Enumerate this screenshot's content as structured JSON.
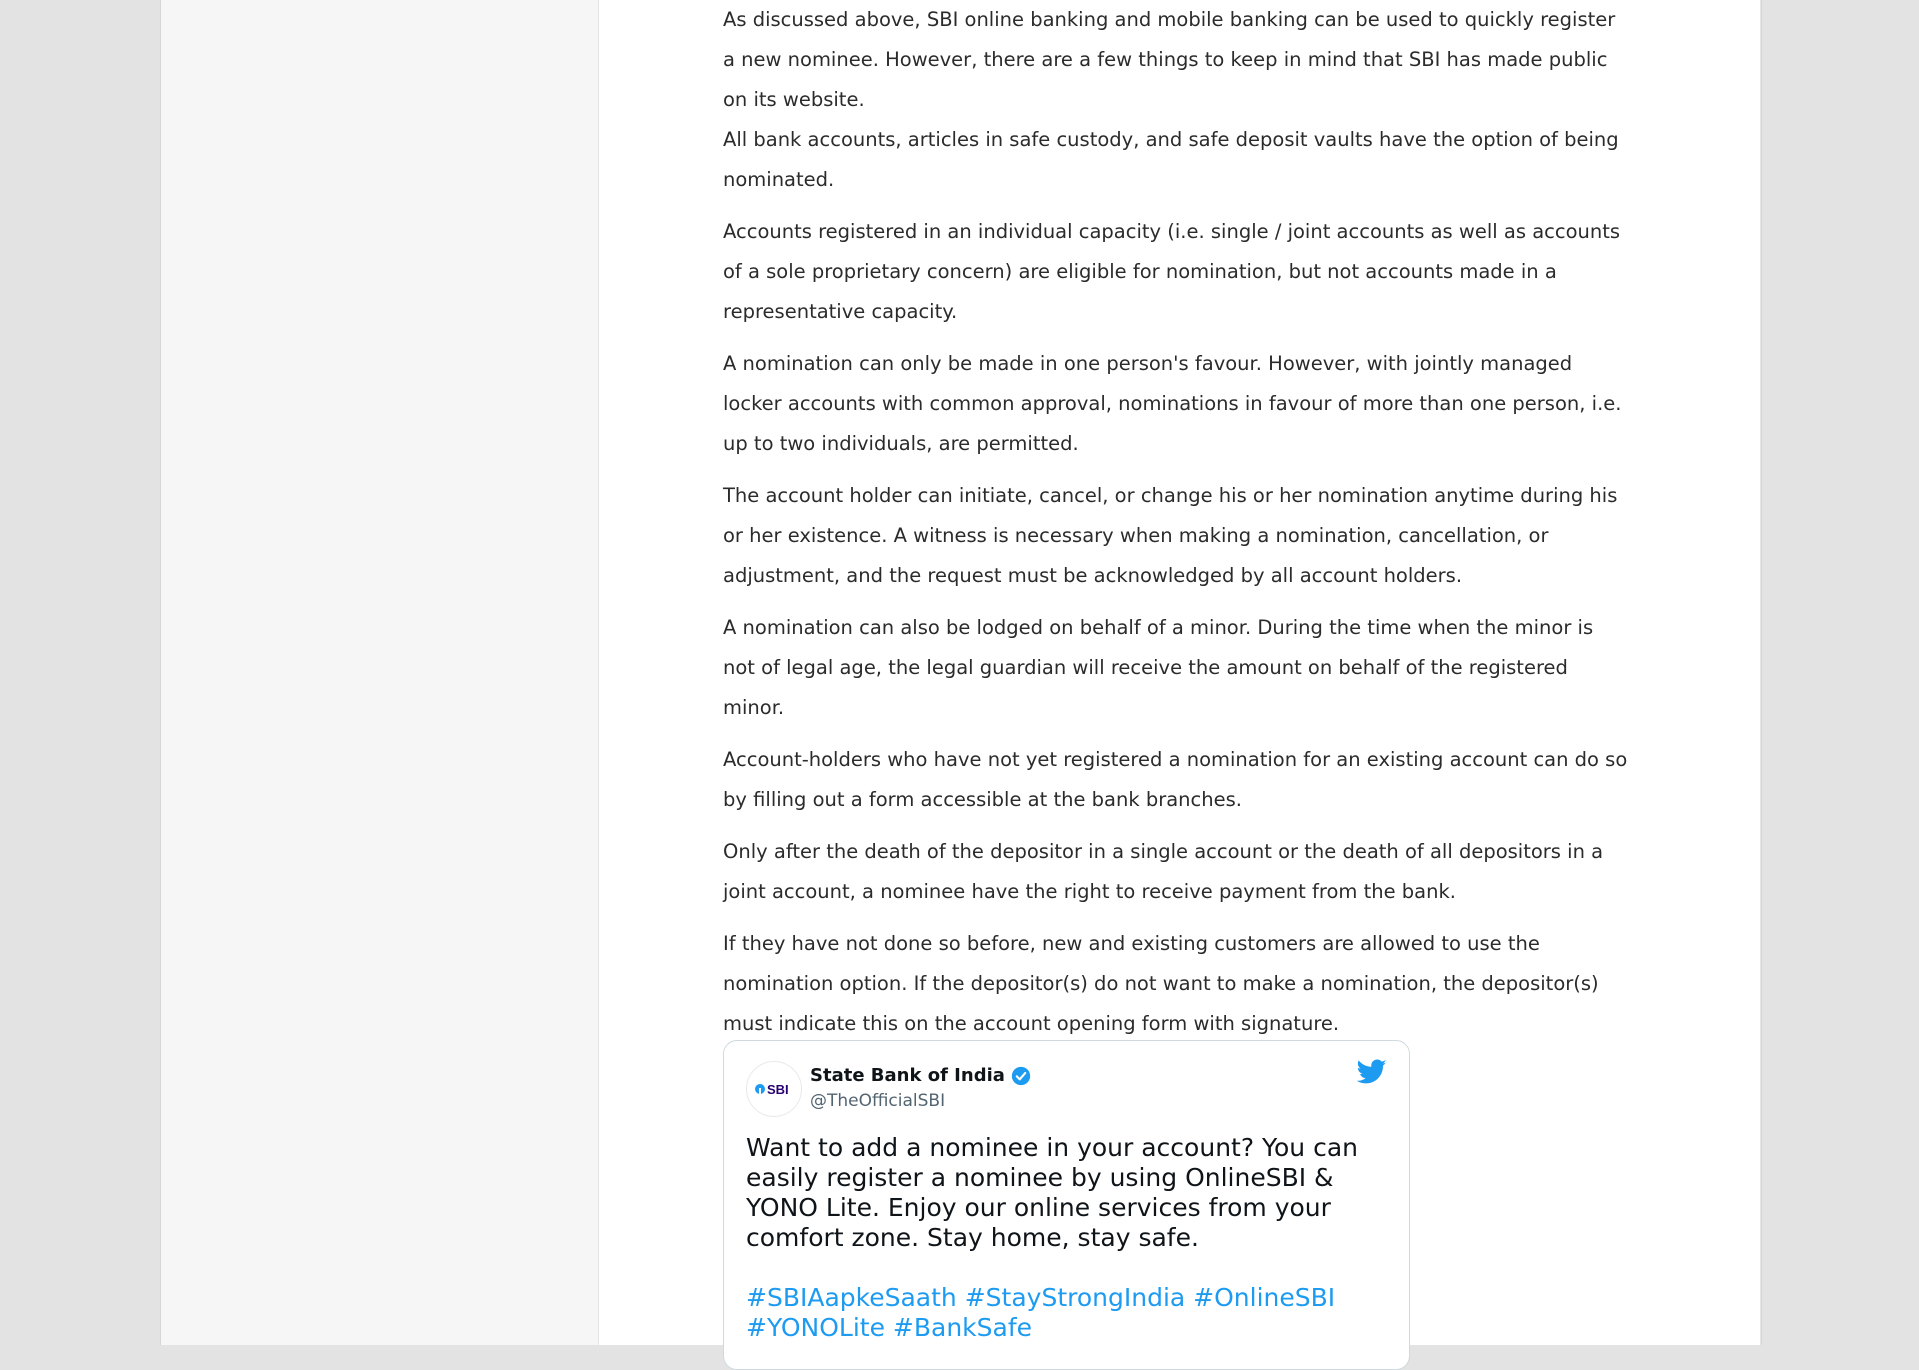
{
  "article": {
    "paragraphs": [
      "As discussed above, SBI online banking and mobile banking can be used to quickly register a new nominee. However, there are a few things to keep in mind that SBI has made public on its website.",
      "All bank accounts, articles in safe custody, and safe deposit vaults have the option of being nominated.",
      "Accounts registered in an individual capacity (i.e. single / joint accounts as well as accounts of a sole proprietary concern) are eligible for nomination, but not accounts made in a representative capacity.",
      "A nomination can only be made in one person's favour. However, with jointly managed locker accounts with common approval, nominations in favour of more than one person, i.e. up to two individuals, are permitted.",
      "The account holder can initiate, cancel, or change his or her nomination anytime during his or her existence. A witness is necessary when making a nomination, cancellation, or adjustment, and the request must be acknowledged by all account holders.",
      "A nomination can also be lodged on behalf of a minor. During the time when the minor is not of legal age, the legal guardian will receive the amount on behalf of the registered minor.",
      "Account-holders who have not yet registered a nomination for an existing account can do so by filling out a form accessible at the bank branches.",
      "Only after the death of the depositor in a single account or the death of all depositors in a joint account, a nominee have the right to receive payment from the bank.",
      "If they have not done so before, new and existing customers are allowed to use the nomination option. If the depositor(s) do not want to make a nomination, the depositor(s) must indicate this on the account opening form with signature."
    ]
  },
  "tweet": {
    "avatar_text": "SBI",
    "name": "State Bank of India",
    "handle": "@TheOfficialSBI",
    "text": "Want to add a nominee in your account? You can easily register a nominee by using OnlineSBI & YONO Lite. Enjoy our online services from your comfort zone. Stay home, stay safe.",
    "hashtags": [
      "#SBIAapkeSaath",
      "#StayStrongIndia",
      "#OnlineSBI",
      "#YONOLite",
      "#BankSafe"
    ],
    "icons": {
      "verified": "verified-badge-icon",
      "platform": "twitter-bird-icon"
    },
    "colors": {
      "link": "#1d9bf0",
      "verified": "#1d9bf0",
      "brand": "#280071"
    }
  }
}
